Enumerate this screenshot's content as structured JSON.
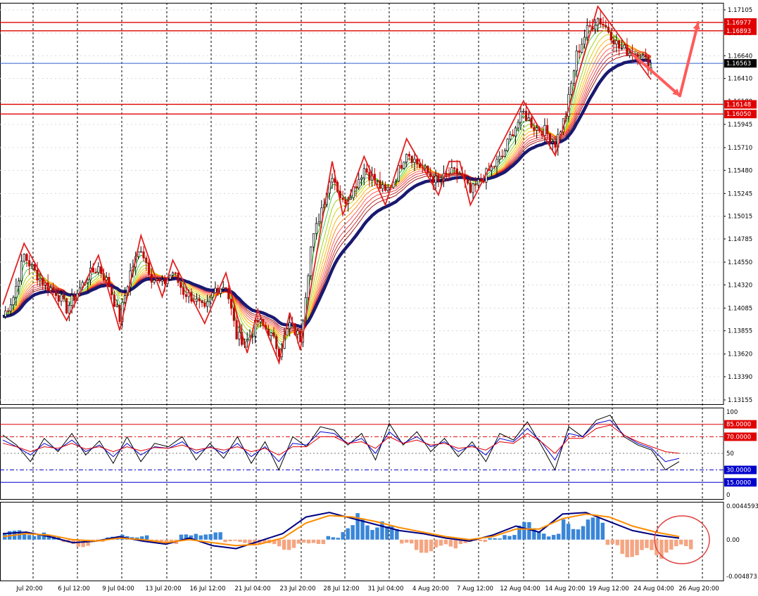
{
  "chart_data": [
    {
      "panel": "price",
      "type": "candlestick",
      "instrument_hint": "EURUSD H4 style",
      "y_ticks": [
        "1.17105",
        "1.16870",
        "1.16640",
        "1.16410",
        "1.16180",
        "1.15945",
        "1.15710",
        "1.15480",
        "1.15245",
        "1.15015",
        "1.14785",
        "1.14550",
        "1.14320",
        "1.14085",
        "1.13855",
        "1.13620",
        "1.13390",
        "1.13155"
      ],
      "ylim": [
        1.13155,
        1.17105
      ],
      "price_labels": [
        {
          "value": "1.16977",
          "color": "#e00000"
        },
        {
          "value": "1.16893",
          "color": "#e00000"
        },
        {
          "value": "1.16563",
          "color": "#000000"
        },
        {
          "value": "1.16148",
          "color": "#e00000"
        },
        {
          "value": "1.16050",
          "color": "#e00000"
        }
      ],
      "horizontal_lines": [
        1.16977,
        1.16893,
        1.16563,
        1.16148,
        1.1605
      ],
      "close_path": [
        1.14,
        1.142,
        1.1462,
        1.1445,
        1.1432,
        1.1425,
        1.1408,
        1.1424,
        1.1441,
        1.145,
        1.1432,
        1.1398,
        1.1445,
        1.147,
        1.144,
        1.1432,
        1.1445,
        1.1425,
        1.1418,
        1.1405,
        1.1428,
        1.1432,
        1.138,
        1.1375,
        1.1395,
        1.1385,
        1.1365,
        1.1392,
        1.1378,
        1.147,
        1.151,
        1.1545,
        1.1515,
        1.153,
        1.155,
        1.1538,
        1.1525,
        1.1542,
        1.1568,
        1.1555,
        1.1545,
        1.1535,
        1.1545,
        1.1545,
        1.1525,
        1.1538,
        1.155,
        1.1562,
        1.1588,
        1.1606,
        1.1592,
        1.1588,
        1.1575,
        1.1605,
        1.1665,
        1.169,
        1.1702,
        1.169,
        1.1672,
        1.1668,
        1.1665,
        1.1652
      ]
    },
    {
      "panel": "oscillator",
      "type": "line",
      "y_ticks": [
        "100",
        "50",
        "0"
      ],
      "levels": [
        {
          "value": "85.0000",
          "color": "#e00000"
        },
        {
          "value": "70.0000",
          "color": "#e00000"
        },
        {
          "value": "30.0000",
          "color": "#0000cc"
        },
        {
          "value": "15.0000",
          "color": "#0000cc"
        }
      ],
      "series": [
        {
          "color": "#000000",
          "values": [
            72,
            60,
            40,
            68,
            52,
            74,
            48,
            65,
            38,
            70,
            40,
            62,
            58,
            70,
            42,
            62,
            44,
            70,
            38,
            64,
            30,
            70,
            58,
            82,
            78,
            60,
            74,
            42,
            86,
            60,
            76,
            52,
            68,
            46,
            64,
            40,
            74,
            66,
            88,
            60,
            30,
            82,
            70,
            90,
            96,
            70,
            60,
            54,
            30,
            40
          ]
        },
        {
          "color": "#0000cc",
          "values": [
            66,
            58,
            48,
            62,
            54,
            66,
            52,
            60,
            46,
            62,
            48,
            58,
            56,
            64,
            50,
            58,
            50,
            62,
            46,
            58,
            40,
            62,
            60,
            76,
            74,
            62,
            68,
            50,
            76,
            62,
            70,
            58,
            64,
            52,
            60,
            48,
            68,
            64,
            80,
            64,
            42,
            74,
            70,
            86,
            90,
            72,
            62,
            56,
            40,
            44
          ]
        },
        {
          "color": "#e00000",
          "values": [
            62,
            58,
            52,
            58,
            56,
            62,
            55,
            58,
            52,
            58,
            53,
            57,
            56,
            60,
            54,
            57,
            54,
            58,
            52,
            56,
            48,
            58,
            58,
            70,
            70,
            62,
            64,
            56,
            70,
            62,
            66,
            60,
            62,
            56,
            58,
            54,
            64,
            62,
            74,
            64,
            50,
            68,
            68,
            80,
            84,
            72,
            64,
            58,
            52,
            50
          ]
        }
      ]
    },
    {
      "panel": "histogram",
      "type": "bar+line",
      "y_ticks": [
        "0.0044593",
        "0.00",
        "-0.004873"
      ],
      "ylim": [
        -0.004873,
        0.0044593
      ],
      "bars": [
        0.0012,
        0.0015,
        0.001,
        0.0005,
        -0.0008,
        -0.001,
        -0.0006,
        0.0004,
        0.0008,
        0.0006,
        -0.0004,
        -0.0008,
        0.0007,
        0.0014,
        0.001,
        -0.0004,
        -0.0006,
        -0.0008,
        -0.0012,
        -0.0014,
        -0.001,
        -0.0006,
        0.0006,
        0.002,
        0.0036,
        0.0032,
        0.0018,
        -0.001,
        -0.0018,
        -0.002,
        -0.0012,
        -0.0006,
        -0.0004,
        0.0002,
        0.0012,
        0.0024,
        0.002,
        0.0008,
        0.0028,
        0.0034,
        0.003,
        -0.0014,
        -0.0024,
        -0.0028,
        -0.0026,
        -0.0018,
        -0.0016
      ],
      "series": [
        {
          "color": "#000080",
          "values": [
            0.0008,
            0.001,
            0.0004,
            -0.0004,
            -0.0002,
            0.0004,
            -0.0002,
            -0.0006,
            0.0002,
            -0.0008,
            -0.0012,
            -0.0002,
            0.0008,
            0.003,
            0.0036,
            0.0028,
            0.002,
            0.0012,
            0.0008,
            0.0002,
            -0.0002,
            0.0006,
            0.0018,
            0.001,
            0.0034,
            0.0036,
            0.0024,
            0.0012,
            0.0006,
            0.0002
          ]
        },
        {
          "color": "#ff8c00",
          "values": [
            0.0004,
            0.0008,
            0.0006,
            0.0,
            -0.0002,
            0.0002,
            0.0,
            -0.0004,
            0.0,
            -0.0004,
            -0.0008,
            -0.0006,
            0.0002,
            0.0022,
            0.0032,
            0.003,
            0.0024,
            0.0016,
            0.001,
            0.0004,
            0.0,
            0.0004,
            0.0014,
            0.0014,
            0.0028,
            0.0034,
            0.003,
            0.0018,
            0.001,
            0.0004
          ]
        }
      ]
    }
  ],
  "x_axis": {
    "labels": [
      "Jul 20:00",
      "6 Jul 12:00",
      "9 Jul 04:00",
      "13 Jul 20:00",
      "16 Jul 12:00",
      "21 Jul 04:00",
      "23 Jul 20:00",
      "28 Jul 12:00",
      "31 Jul 04:00",
      "4 Aug 20:00",
      "7 Aug 12:00",
      "12 Aug 04:00",
      "14 Aug 20:00",
      "19 Aug 12:00",
      "24 Aug 04:00",
      "26 Aug 20:00"
    ]
  },
  "colors": {
    "background": "#ffffff",
    "grid": "#000000",
    "bull": "#000000",
    "bear": "#c00000",
    "zigzag": "#e02020",
    "arrow": "#ff5a5a",
    "slow_ma": "#191970"
  }
}
